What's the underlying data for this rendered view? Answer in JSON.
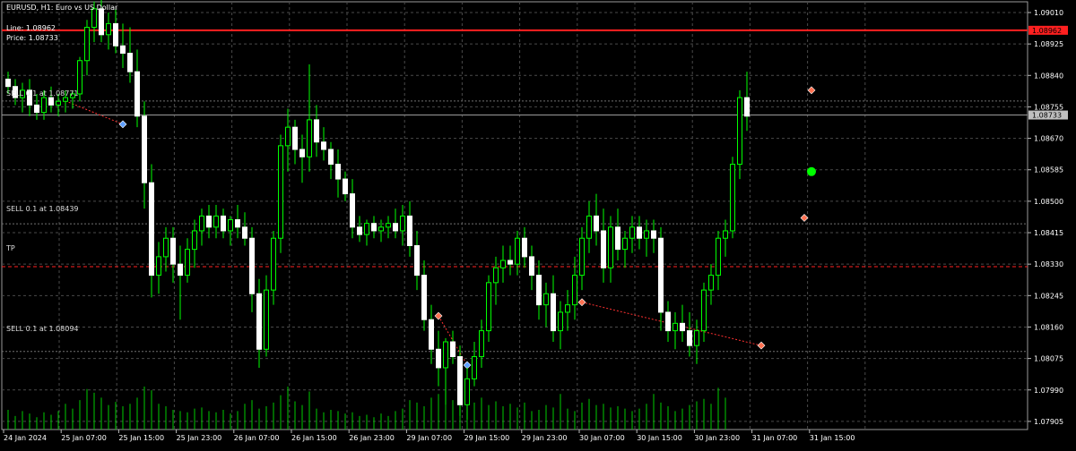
{
  "header": {
    "title": "EURUSD, H1:  Euro vs US Dollar",
    "line_readout": "Line: 1.08962",
    "price_readout": "Price: 1.08733"
  },
  "colors": {
    "background": "#000000",
    "grid": "#4a4a4a",
    "bull": "#00ff00",
    "volume": "#00cc00",
    "red_line": "#ff2020",
    "current_price_tag": "#c0c0c0",
    "level_line": "#707070",
    "tp_line": "#ff2020",
    "trade_link": "#ff3030",
    "sell_arrow": "#ff7050",
    "buy_arrow": "#60a0ff",
    "marker": "#00ff00"
  },
  "levels": {
    "red_line_value": "1.08962",
    "current_value": "1.08733",
    "labels": [
      {
        "id": "sell1",
        "text": "SELL 0.1 at 1.08771",
        "price": 1.08771
      },
      {
        "id": "sell2",
        "text": "SELL 0.1 at 1.08439",
        "price": 1.08439
      },
      {
        "id": "tp",
        "text": "TP",
        "price": 1.08323
      },
      {
        "id": "sell3",
        "text": "SELL 0.1 at 1.08094",
        "price": 1.08094
      }
    ]
  },
  "chart_data": {
    "type": "candlestick",
    "symbol": "EURUSD",
    "timeframe": "H1",
    "y_ticks": [
      "1.09010",
      "1.08925",
      "1.08840",
      "1.08755",
      "1.08670",
      "1.08585",
      "1.08500",
      "1.08415",
      "1.08330",
      "1.08245",
      "1.08160",
      "1.08075",
      "1.07990",
      "1.07905"
    ],
    "ylim": [
      1.07883,
      1.09039
    ],
    "x_ticks": [
      "24 Jan 2024",
      "25 Jan 07:00",
      "25 Jan 15:00",
      "25 Jan 23:00",
      "26 Jan 07:00",
      "26 Jan 15:00",
      "26 Jan 23:00",
      "29 Jan 07:00",
      "29 Jan 15:00",
      "29 Jan 23:00",
      "30 Jan 07:00",
      "30 Jan 15:00",
      "30 Jan 23:00",
      "31 Jan 07:00",
      "31 Jan 15:00"
    ],
    "red_line": 1.08962,
    "current_price": 1.08733,
    "candles": [
      [
        1.0883,
        1.0885,
        1.0879,
        1.0881
      ],
      [
        1.0881,
        1.0883,
        1.0876,
        1.0878
      ],
      [
        1.0878,
        1.0882,
        1.0874,
        1.088
      ],
      [
        1.088,
        1.0883,
        1.0873,
        1.0876
      ],
      [
        1.0876,
        1.0879,
        1.0872,
        1.0874
      ],
      [
        1.0874,
        1.088,
        1.0872,
        1.0878
      ],
      [
        1.0878,
        1.0881,
        1.0874,
        1.0876
      ],
      [
        1.0876,
        1.0879,
        1.0873,
        1.0877
      ],
      [
        1.0877,
        1.088,
        1.0874,
        1.0878
      ],
      [
        1.0878,
        1.088,
        1.0875,
        1.0879
      ],
      [
        1.0879,
        1.0889,
        1.0877,
        1.0888
      ],
      [
        1.0888,
        1.0899,
        1.0884,
        1.0897
      ],
      [
        1.0897,
        1.0904,
        1.0893,
        1.0902
      ],
      [
        1.0902,
        1.0908,
        1.0893,
        1.0895
      ],
      [
        1.0895,
        1.0901,
        1.0891,
        1.0898
      ],
      [
        1.0898,
        1.0902,
        1.089,
        1.0892
      ],
      [
        1.0892,
        1.0898,
        1.0886,
        1.089
      ],
      [
        1.089,
        1.0897,
        1.0882,
        1.0885
      ],
      [
        1.0885,
        1.0891,
        1.087,
        1.0873
      ],
      [
        1.0873,
        1.0877,
        1.0848,
        1.0855
      ],
      [
        1.0855,
        1.086,
        1.0824,
        1.083
      ],
      [
        1.083,
        1.0839,
        1.0825,
        1.0835
      ],
      [
        1.0835,
        1.0843,
        1.0831,
        1.084
      ],
      [
        1.084,
        1.0843,
        1.0828,
        1.0833
      ],
      [
        1.0833,
        1.0838,
        1.0818,
        1.083
      ],
      [
        1.083,
        1.084,
        1.0828,
        1.0837
      ],
      [
        1.0837,
        1.0845,
        1.0832,
        1.0842
      ],
      [
        1.0842,
        1.0848,
        1.0838,
        1.0846
      ],
      [
        1.0846,
        1.0849,
        1.084,
        1.0843
      ],
      [
        1.0843,
        1.0849,
        1.084,
        1.0846
      ],
      [
        1.0846,
        1.0848,
        1.084,
        1.0842
      ],
      [
        1.0842,
        1.0846,
        1.0838,
        1.0845
      ],
      [
        1.0845,
        1.0849,
        1.084,
        1.0843
      ],
      [
        1.0843,
        1.0847,
        1.0838,
        1.084
      ],
      [
        1.084,
        1.0843,
        1.082,
        1.0825
      ],
      [
        1.0825,
        1.0829,
        1.0805,
        1.081
      ],
      [
        1.081,
        1.083,
        1.0808,
        1.0826
      ],
      [
        1.0826,
        1.0842,
        1.0822,
        1.084
      ],
      [
        1.084,
        1.0868,
        1.0836,
        1.0865
      ],
      [
        1.0865,
        1.0875,
        1.0858,
        1.087
      ],
      [
        1.087,
        1.0872,
        1.086,
        1.0864
      ],
      [
        1.0864,
        1.0868,
        1.0855,
        1.0862
      ],
      [
        1.0862,
        1.0887,
        1.0858,
        1.0872
      ],
      [
        1.0872,
        1.0876,
        1.0862,
        1.0866
      ],
      [
        1.0866,
        1.087,
        1.0861,
        1.0864
      ],
      [
        1.0864,
        1.0866,
        1.0856,
        1.086
      ],
      [
        1.086,
        1.0864,
        1.0851,
        1.0856
      ],
      [
        1.0856,
        1.0858,
        1.085,
        1.0852
      ],
      [
        1.0852,
        1.0856,
        1.084,
        1.0843
      ],
      [
        1.0843,
        1.0846,
        1.0839,
        1.0841
      ],
      [
        1.0841,
        1.0845,
        1.0838,
        1.0844
      ],
      [
        1.0844,
        1.0846,
        1.084,
        1.0842
      ],
      [
        1.0842,
        1.0845,
        1.0839,
        1.0843
      ],
      [
        1.0843,
        1.0846,
        1.084,
        1.0844
      ],
      [
        1.0844,
        1.0848,
        1.084,
        1.0842
      ],
      [
        1.0842,
        1.0849,
        1.0838,
        1.0846
      ],
      [
        1.0846,
        1.085,
        1.0835,
        1.0838
      ],
      [
        1.0838,
        1.0842,
        1.0826,
        1.083
      ],
      [
        1.083,
        1.0834,
        1.0815,
        1.0818
      ],
      [
        1.0818,
        1.0822,
        1.0806,
        1.081
      ],
      [
        1.081,
        1.0815,
        1.08,
        1.0805
      ],
      [
        1.0805,
        1.0813,
        1.0795,
        1.0812
      ],
      [
        1.0812,
        1.0815,
        1.0806,
        1.0808
      ],
      [
        1.0808,
        1.0811,
        1.0792,
        1.0795
      ],
      [
        1.0795,
        1.0805,
        1.0791,
        1.0802
      ],
      [
        1.0802,
        1.0812,
        1.08,
        1.0808
      ],
      [
        1.0808,
        1.0818,
        1.0805,
        1.0815
      ],
      [
        1.0815,
        1.083,
        1.0812,
        1.0828
      ],
      [
        1.0828,
        1.0835,
        1.0822,
        1.0832
      ],
      [
        1.0832,
        1.0838,
        1.0828,
        1.0834
      ],
      [
        1.0834,
        1.0838,
        1.083,
        1.0833
      ],
      [
        1.0833,
        1.0842,
        1.083,
        1.084
      ],
      [
        1.084,
        1.0843,
        1.0832,
        1.0835
      ],
      [
        1.0835,
        1.0838,
        1.0826,
        1.083
      ],
      [
        1.083,
        1.0834,
        1.0818,
        1.0822
      ],
      [
        1.0822,
        1.0828,
        1.0816,
        1.0825
      ],
      [
        1.0825,
        1.083,
        1.0812,
        1.0815
      ],
      [
        1.0815,
        1.0823,
        1.081,
        1.082
      ],
      [
        1.082,
        1.0826,
        1.0815,
        1.0822
      ],
      [
        1.0822,
        1.0835,
        1.0818,
        1.083
      ],
      [
        1.083,
        1.0843,
        1.0826,
        1.084
      ],
      [
        1.084,
        1.085,
        1.0836,
        1.0846
      ],
      [
        1.0846,
        1.0852,
        1.0838,
        1.0842
      ],
      [
        1.0842,
        1.0848,
        1.0828,
        1.0832
      ],
      [
        1.0832,
        1.0846,
        1.0828,
        1.0843
      ],
      [
        1.0843,
        1.0848,
        1.0834,
        1.0837
      ],
      [
        1.0837,
        1.0842,
        1.0832,
        1.084
      ],
      [
        1.084,
        1.0846,
        1.0836,
        1.0843
      ],
      [
        1.0843,
        1.0846,
        1.0837,
        1.084
      ],
      [
        1.084,
        1.0845,
        1.0835,
        1.0842
      ],
      [
        1.0842,
        1.0845,
        1.0836,
        1.084
      ],
      [
        1.084,
        1.0843,
        1.0815,
        1.082
      ],
      [
        1.082,
        1.0823,
        1.0812,
        1.0815
      ],
      [
        1.0815,
        1.082,
        1.081,
        1.0817
      ],
      [
        1.0817,
        1.0822,
        1.0812,
        1.0815
      ],
      [
        1.0815,
        1.082,
        1.0808,
        1.0811
      ],
      [
        1.0811,
        1.0818,
        1.0806,
        1.0815
      ],
      [
        1.0815,
        1.0828,
        1.0812,
        1.0826
      ],
      [
        1.0826,
        1.0833,
        1.0822,
        1.083
      ],
      [
        1.083,
        1.0842,
        1.0826,
        1.084
      ],
      [
        1.084,
        1.0845,
        1.0835,
        1.0842
      ],
      [
        1.0842,
        1.0862,
        1.084,
        1.086
      ],
      [
        1.086,
        1.088,
        1.0856,
        1.0878
      ],
      [
        1.0878,
        1.0885,
        1.0869,
        1.0873
      ]
    ],
    "volumes": [
      32,
      22,
      30,
      26,
      20,
      28,
      24,
      30,
      42,
      34,
      48,
      66,
      60,
      52,
      40,
      45,
      38,
      42,
      52,
      70,
      64,
      42,
      38,
      32,
      30,
      28,
      34,
      36,
      30,
      28,
      32,
      26,
      30,
      42,
      48,
      34,
      38,
      44,
      56,
      70,
      46,
      40,
      62,
      34,
      28,
      32,
      30,
      26,
      28,
      22,
      24,
      20,
      26,
      22,
      30,
      34,
      48,
      44,
      38,
      52,
      58,
      62,
      48,
      34,
      38,
      44,
      52,
      40,
      46,
      38,
      42,
      36,
      44,
      30,
      32,
      40,
      36,
      58,
      34,
      30,
      44,
      50,
      40,
      42,
      36,
      38,
      34,
      30,
      34,
      42,
      58,
      44,
      38,
      30,
      34,
      40,
      46,
      50,
      42,
      68,
      52
    ]
  }
}
